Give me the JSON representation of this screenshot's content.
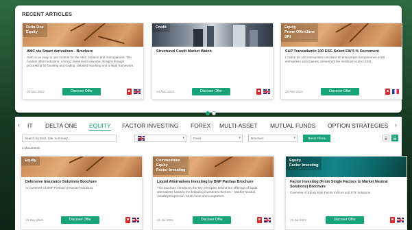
{
  "recent": {
    "title": "RECENT ARTICLES",
    "cards": [
      {
        "tags": [
          "Delta One",
          "Equity"
        ],
        "title": "AMC via Smart derivatives - Brochure",
        "text": "AMC is an easy to use module for the AMC creation and management. The module offers solutions: a broad investment universe, straight-through processing for booking and trading, detailed reporting and a legal framework.",
        "date": "24 Nov 2021",
        "button": "Discover Offer",
        "flag": "uk"
      },
      {
        "tags": [
          "Credit"
        ],
        "title": "Structured Credit Market Watch",
        "text": "",
        "date": "24 Nov 2021",
        "button": "Discover Offer",
        "flag": "uk"
      },
      {
        "tags": [
          "Equity",
          "Prime Offer/Jane",
          "SRI"
        ],
        "title": "S&P Transatlantic 100 ESG Select EW 5 % Decrement",
        "text": "L'indice de 100 entreprises conciliant 50 entreprises européennes et 50 entreprises américaines, présentant les meilleurs scores ESG.",
        "date": "24 Nov 2021",
        "button": "Discover Offer",
        "flag": "fr"
      }
    ]
  },
  "tabs": {
    "prev": "‹",
    "next": "›",
    "items": [
      "IT",
      "DELTA ONE",
      "EQUITY",
      "FACTOR INVESTING",
      "FOREX",
      "MULTI-ASSET",
      "MUTUAL FUNDS",
      "OPTION STRATEGIES"
    ],
    "active": "EQUITY"
  },
  "filters": {
    "search_placeholder": "Search by ESG, title, summary...",
    "country_select": "",
    "type_select": "Fixed",
    "theme_select": "Fixed",
    "document_select": "Brochure",
    "reset_label": "Reset Filters"
  },
  "documents_count": "4 documents",
  "documents": [
    {
      "tags": [
        "Equity"
      ],
      "title": "Defensive Insurance Solutions Brochure",
      "text": "An overview of BNP Paribas' protected solutions.",
      "date": "10 Sep 2021",
      "button": "Discover Offer"
    },
    {
      "tags": [
        "Commodities",
        "Equity",
        "Factor Investing"
      ],
      "title": "Liquid Alternatives Investing by BNP Paribas Brochure",
      "text": "This brochure introduces the key principles behind our offerings of liquid alternatives funds in the following investment themes: - Market Neutral, Volatility/Dispersion, Multi Asset and Long/Short.",
      "date": "22 Jul 2021",
      "button": "Discover Offer"
    },
    {
      "tags": [
        "Equity",
        "Factor Investing"
      ],
      "title": "Factor Investing (From Single Factors to Market Neutral Solutions) Brochure",
      "text": "Overview of Equity Risk Factor Indices and ETF solutions.",
      "date": "23 Jul 2021",
      "button": "Discover Offer"
    }
  ]
}
